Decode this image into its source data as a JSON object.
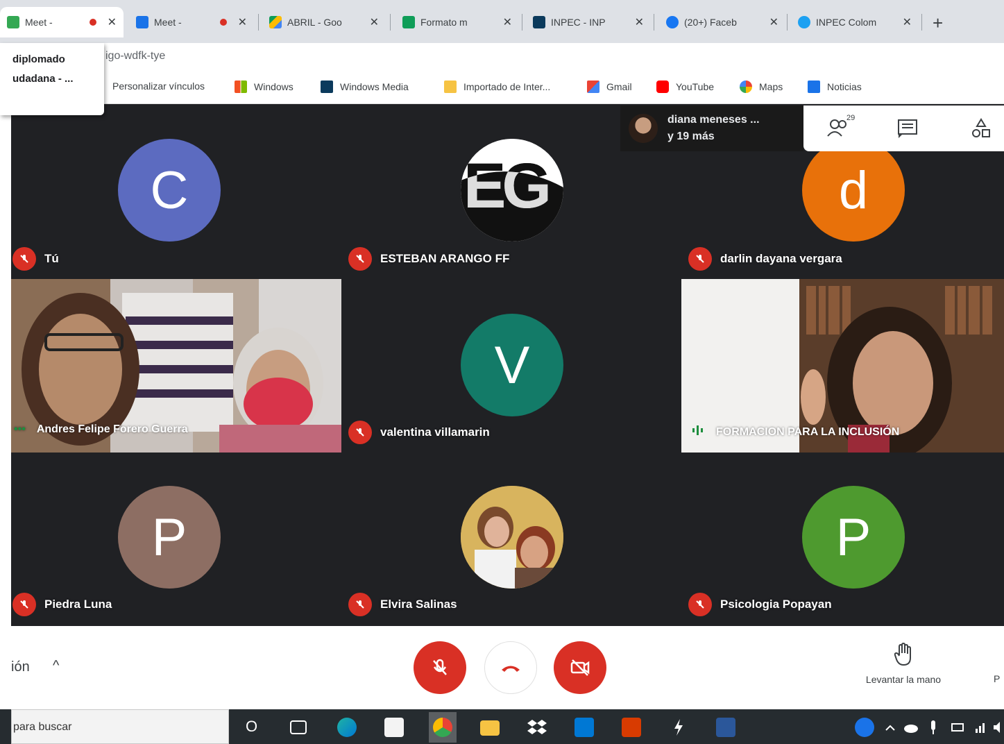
{
  "browser": {
    "tabs": [
      {
        "title": "Meet - ",
        "recording": true,
        "icon": "meet-icon",
        "color": "#34a853",
        "active": true
      },
      {
        "title": "Meet - ",
        "recording": true,
        "icon": "meet-icon",
        "color": "#1a73e8",
        "active": false
      },
      {
        "title": "ABRIL - Goo",
        "recording": false,
        "icon": "drive-icon",
        "color": "#fbbc04",
        "active": false
      },
      {
        "title": "Formato m",
        "recording": false,
        "icon": "sheets-icon",
        "color": "#0f9d58",
        "active": false
      },
      {
        "title": "INPEC - INP",
        "recording": false,
        "icon": "inpec-icon",
        "color": "#0b3a5c",
        "active": false
      },
      {
        "title": "(20+) Faceb",
        "recording": false,
        "icon": "facebook-icon",
        "color": "#1877f2",
        "active": false
      },
      {
        "title": "INPEC Colom",
        "recording": false,
        "icon": "twitter-icon",
        "color": "#1da1f2",
        "active": false
      }
    ],
    "close_glyph": "✕",
    "new_tab_glyph": "+",
    "url_fragment": "igo-wdfk-tye",
    "autocomplete": [
      "diplomado",
      "udadana - ..."
    ],
    "bookmarks": [
      {
        "label": "Personalizar vínculos",
        "icon": "",
        "color": ""
      },
      {
        "label": "Windows",
        "icon": "windows-icon",
        "color": "#0078d4"
      },
      {
        "label": "Windows Media",
        "icon": "windows-media-icon",
        "color": "#0b3a5c"
      },
      {
        "label": "Importado de Inter...",
        "icon": "folder-icon",
        "color": "#f6c343"
      },
      {
        "label": "Gmail",
        "icon": "gmail-icon",
        "color": "#ea4335"
      },
      {
        "label": "YouTube",
        "icon": "youtube-icon",
        "color": "#ff0000"
      },
      {
        "label": "Maps",
        "icon": "google-icon",
        "color": "#4285f4"
      },
      {
        "label": "Noticias",
        "icon": "news-icon",
        "color": "#1a73e8"
      }
    ]
  },
  "meet": {
    "presenter": {
      "line1": "diana meneses ...",
      "line2": "y 19 más"
    },
    "participant_count": "29",
    "participants": [
      {
        "name": "Tú",
        "kind": "avatar",
        "letter": "C",
        "color": "#5c6bc0",
        "muted": true
      },
      {
        "name": "ESTEBAN ARANGO FF",
        "kind": "logo",
        "letter": "EG",
        "color": "#ffffff",
        "muted": true
      },
      {
        "name": "darlin dayana vergara",
        "kind": "avatar",
        "letter": "d",
        "color": "#e8710a",
        "muted": true
      },
      {
        "name": "Andres Felipe Forero Guerra",
        "kind": "video",
        "letter": "",
        "color": "",
        "muted": false
      },
      {
        "name": "valentina villamarin",
        "kind": "avatar",
        "letter": "V",
        "color": "#137b68",
        "muted": true
      },
      {
        "name": "FORMACION PARA LA INCLUSIÓN",
        "kind": "video",
        "letter": "",
        "color": "",
        "muted": false
      },
      {
        "name": "Piedra Luna",
        "kind": "avatar",
        "letter": "P",
        "color": "#8d6e63",
        "muted": true
      },
      {
        "name": "Elvira Salinas",
        "kind": "photo",
        "letter": "",
        "color": "",
        "muted": true
      },
      {
        "name": "Psicologia Popayan",
        "kind": "avatar",
        "letter": "P",
        "color": "#4e9a2f",
        "muted": true
      }
    ],
    "controls": {
      "left_label": "ión",
      "chevron": "^",
      "raise_hand": "Levantar la mano",
      "right_cut": "P"
    }
  },
  "taskbar": {
    "search_placeholder": "para buscar",
    "cortana_glyph": "O"
  }
}
